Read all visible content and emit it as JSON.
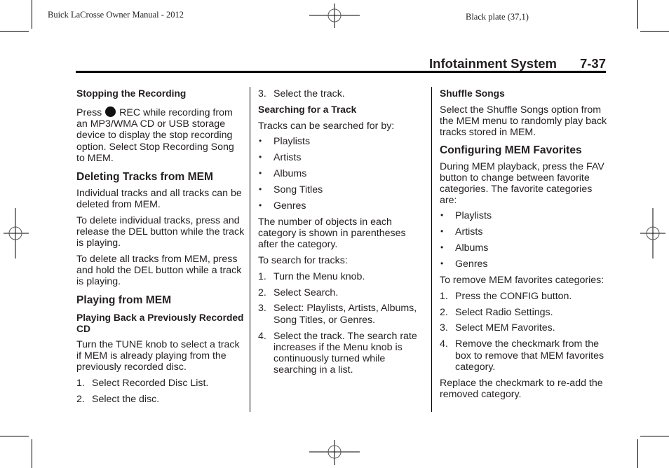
{
  "print_meta": {
    "left": "Buick LaCrosse Owner Manual - 2012",
    "right": "Black plate (37,1)"
  },
  "header": {
    "section": "Infotainment System",
    "page": "7-37"
  },
  "icons": {
    "rec": "record-dot-icon",
    "bullet": "•"
  },
  "col1": {
    "stop_heading": "Stopping the Recording",
    "stop_pre": "Press",
    "stop_post": "REC while recording from an MP3/WMA CD or USB storage device to display the stop recording option. Select Stop Recording Song to MEM.",
    "delete_heading": "Deleting Tracks from MEM",
    "delete_p1": "Individual tracks and all tracks can be deleted from MEM.",
    "delete_p2": "To delete individual tracks, press and release the DEL button while the track is playing.",
    "delete_p3": "To delete all tracks from MEM, press and hold the DEL button while a track is playing.",
    "play_heading": "Playing from MEM",
    "playback_heading": "Playing Back a Previously Recorded CD",
    "playback_p": "Turn the TUNE knob to select a track if MEM is already playing from the previously recorded disc.",
    "steps": [
      {
        "n": "1.",
        "text": "Select Recorded Disc List."
      },
      {
        "n": "2.",
        "text": "Select the disc."
      }
    ]
  },
  "col2": {
    "steps_cont": [
      {
        "n": "3.",
        "text": "Select the track."
      }
    ],
    "search_heading": "Searching for a Track",
    "search_intro": "Tracks can be searched for by:",
    "search_bullets": [
      "Playlists",
      "Artists",
      "Albums",
      "Song Titles",
      "Genres"
    ],
    "search_p": "The number of objects in each category is shown in parentheses after the category.",
    "search_steps_intro": "To search for tracks:",
    "search_steps": [
      {
        "n": "1.",
        "text": "Turn the Menu knob."
      },
      {
        "n": "2.",
        "text": "Select Search."
      },
      {
        "n": "3.",
        "text": "Select: Playlists, Artists, Albums, Song Titles, or Genres."
      },
      {
        "n": "4.",
        "text": "Select the track. The search rate increases if the Menu knob is continuously turned while searching in a list."
      }
    ]
  },
  "col3": {
    "shuffle_heading": "Shuffle Songs",
    "shuffle_p": "Select the Shuffle Songs option from the MEM menu to randomly play back tracks stored in MEM.",
    "config_heading": "Configuring MEM Favorites",
    "config_p": "During MEM playback, press the FAV button to change between favorite categories. The favorite categories are:",
    "config_bullets": [
      "Playlists",
      "Artists",
      "Albums",
      "Genres"
    ],
    "remove_intro": "To remove MEM favorites categories:",
    "remove_steps": [
      {
        "n": "1.",
        "text": "Press the CONFIG button."
      },
      {
        "n": "2.",
        "text": "Select Radio Settings."
      },
      {
        "n": "3.",
        "text": "Select MEM Favorites."
      },
      {
        "n": "4.",
        "text": "Remove the checkmark from the box to remove that MEM favorites category."
      }
    ],
    "replace_p": "Replace the checkmark to re-add the removed category."
  }
}
